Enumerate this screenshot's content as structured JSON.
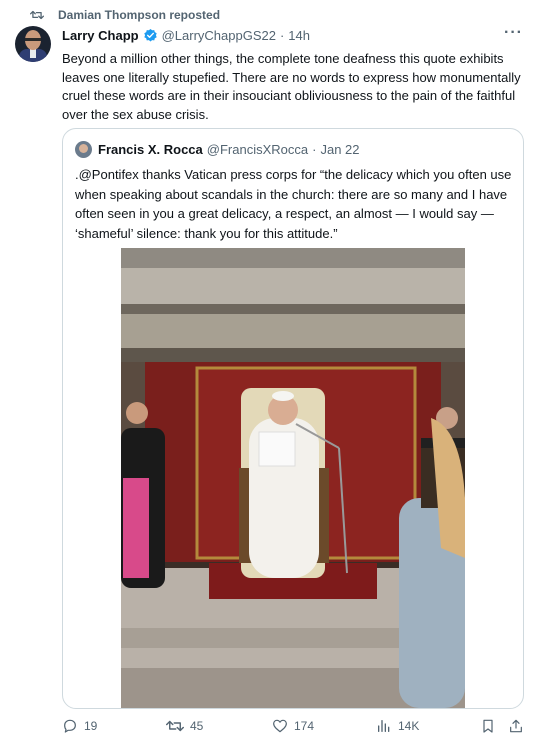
{
  "repost": {
    "text": "Damian Thompson reposted"
  },
  "tweet": {
    "author_name": "Larry Chapp",
    "handle": "@LarryChappGS22",
    "separator": "·",
    "time": "14h",
    "text": "Beyond a million other things, the complete tone deafness this quote exhibits leaves one literally stupefied. There are no words to express how monumentally cruel these words are in their insouciant obliviousness to the pain of the faithful over the sex abuse crisis."
  },
  "quoted": {
    "author_name": "Francis X. Rocca",
    "handle": "@FrancisXRocca",
    "separator": "·",
    "time": "Jan 22",
    "text": ".@Pontifex thanks Vatican press corps for “the delicacy which you often use when speaking about scandals in the church: there are so many and I have often seen in you a great delicacy, a respect, an almost — I would say — ‘shameful’ silence: thank you for this attitude.”"
  },
  "actions": {
    "replies": "19",
    "reposts": "45",
    "likes": "174",
    "views": "14K"
  },
  "colors": {
    "verified": "#1d9bf0",
    "secondary_text": "#536471",
    "border": "#cfd9de"
  },
  "icons": [
    "repost-icon",
    "verified-badge-icon",
    "more-icon",
    "reply-icon",
    "like-icon",
    "views-icon",
    "bookmark-icon",
    "share-icon"
  ]
}
